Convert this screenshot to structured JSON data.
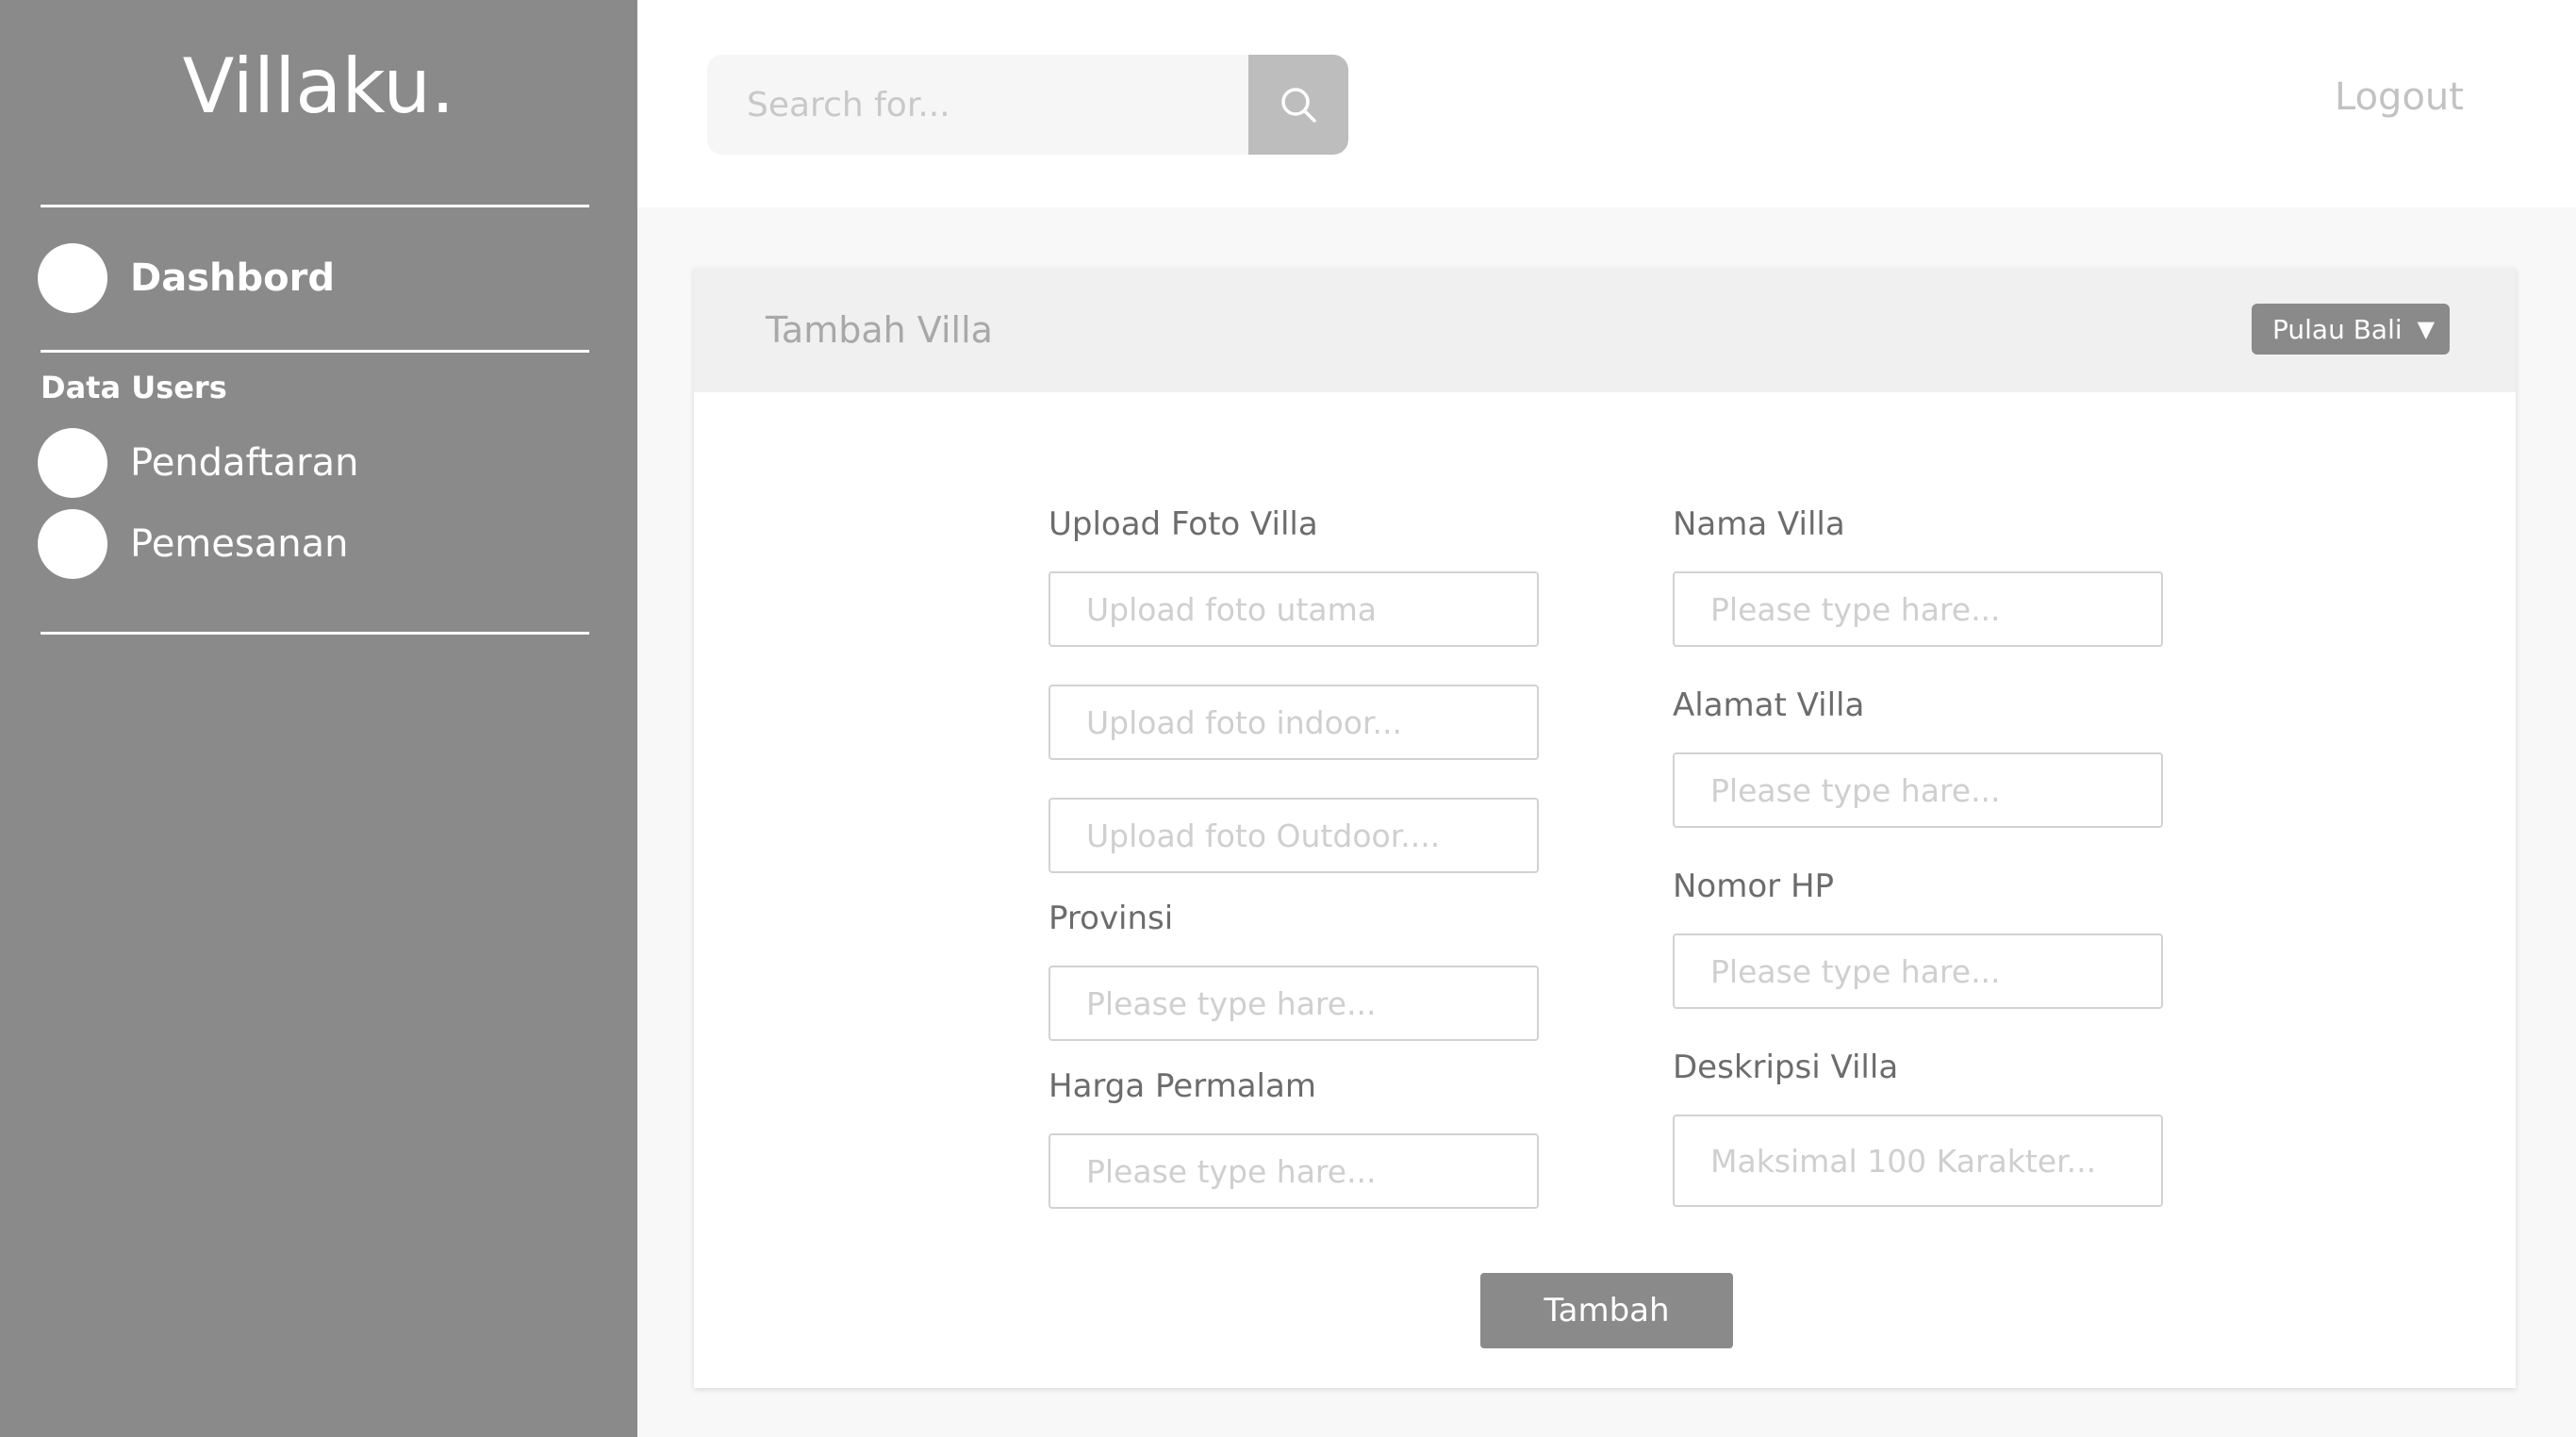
{
  "sidebar": {
    "brand": "Villaku.",
    "dashboard_label": "Dashbord",
    "section_label": "Data Users",
    "items": [
      {
        "label": "Pendaftaran"
      },
      {
        "label": "Pemesanan"
      }
    ]
  },
  "topbar": {
    "search_placeholder": "Search for...",
    "logout_label": "Logout"
  },
  "card": {
    "title": "Tambah Villa",
    "region_selected": "Pulau Bali",
    "left_column": {
      "upload_label": "Upload Foto Villa",
      "upload_main_placeholder": "Upload foto utama",
      "upload_indoor_placeholder": "Upload foto indoor...",
      "upload_outdoor_placeholder": "Upload foto Outdoor....",
      "province_label": "Provinsi",
      "province_placeholder": "Please type hare...",
      "price_label": "Harga Permalam",
      "price_placeholder": "Please type hare..."
    },
    "right_column": {
      "name_label": "Nama Villa",
      "name_placeholder": "Please type hare...",
      "address_label": "Alamat Villa",
      "address_placeholder": "Please type hare...",
      "phone_label": "Nomor HP",
      "phone_placeholder": "Please type hare...",
      "description_label": "Deskripsi Villa",
      "description_placeholder": "Maksimal 100 Karakter..."
    },
    "submit_label": "Tambah"
  },
  "colors": {
    "sidebar_bg": "#8a8a8a",
    "accent": "#8a8a8a",
    "search_button": "#bdbdbd",
    "page_bg": "#f8f8f8"
  }
}
